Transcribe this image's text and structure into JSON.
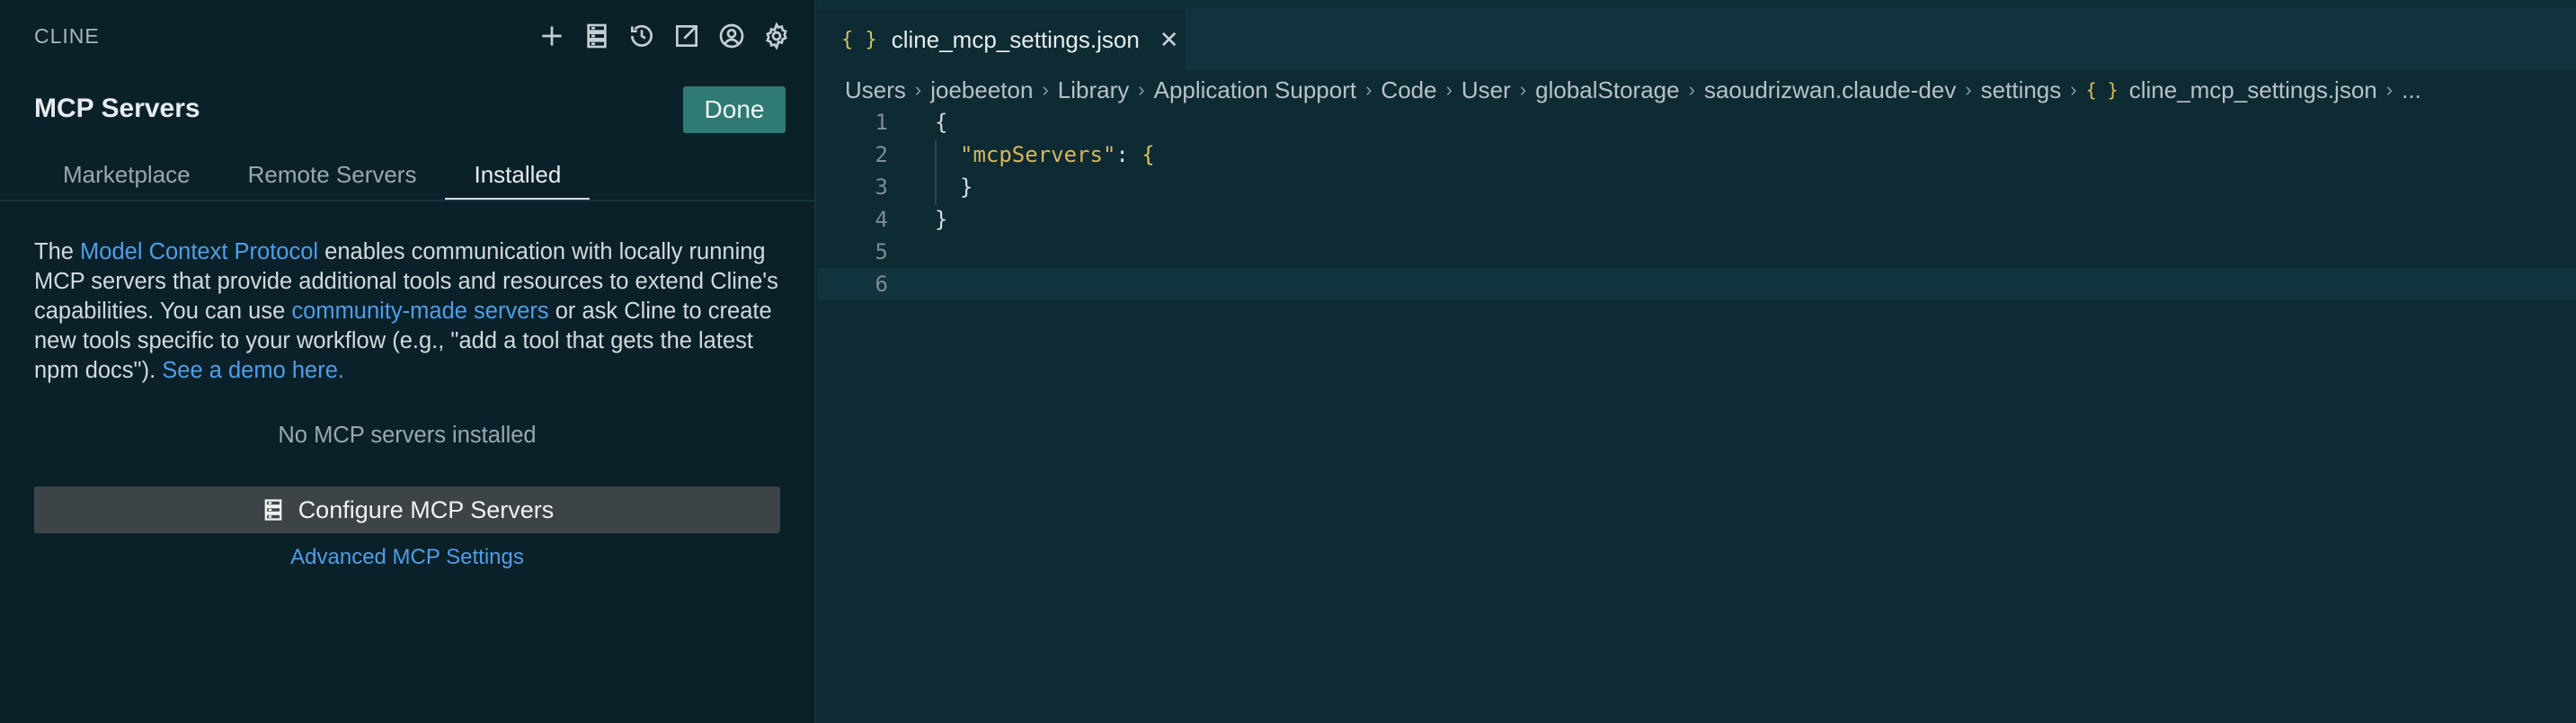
{
  "sidebar": {
    "app_title": "CLINE",
    "toolbar_icons": [
      "plus-icon",
      "server-icon",
      "history-icon",
      "external-link-icon",
      "account-icon",
      "gear-icon"
    ],
    "title": "MCP Servers",
    "done_label": "Done",
    "tabs": [
      {
        "label": "Marketplace",
        "active": false
      },
      {
        "label": "Remote Servers",
        "active": false
      },
      {
        "label": "Installed",
        "active": true
      }
    ],
    "intro": {
      "t1": "The ",
      "link1": "Model Context Protocol",
      "t2": " enables communication with locally running MCP servers that provide additional tools and resources to extend Cline's capabilities. You can use ",
      "link2": "community-made servers",
      "t3": " or ask Cline to create new tools specific to your workflow (e.g., \"add a tool that gets the latest npm docs\"). ",
      "link3": "See a demo here."
    },
    "empty_message": "No MCP servers installed",
    "configure_label": "Configure MCP Servers",
    "advanced_label": "Advanced MCP Settings"
  },
  "editor": {
    "tab": {
      "glyph": "{ }",
      "name": "cline_mcp_settings.json"
    },
    "breadcrumb": [
      "Users",
      "joebeeton",
      "Library",
      "Application Support",
      "Code",
      "User",
      "globalStorage",
      "saoudrizwan.claude-dev",
      "settings"
    ],
    "breadcrumb_file": "cline_mcp_settings.json",
    "breadcrumb_more": "...",
    "lines": [
      "1",
      "2",
      "3",
      "4",
      "5",
      "6"
    ],
    "code": {
      "l1": "{",
      "l2_key": "\"mcpServers\"",
      "l2_colon": ": ",
      "l2_brace": "{",
      "l3_brace": "}",
      "l4": "}"
    }
  },
  "colors": {
    "accent_button": "#2f7a73",
    "link": "#4f9ee8",
    "json_string": "#d9b65b"
  }
}
